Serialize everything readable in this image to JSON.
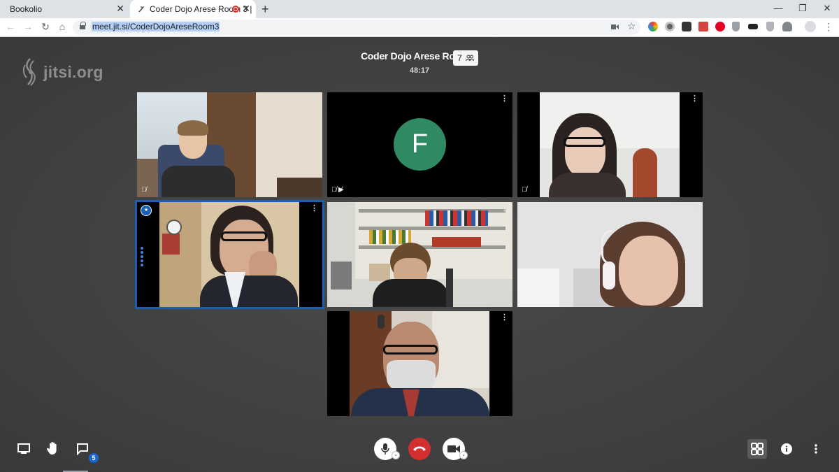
{
  "browser": {
    "tabs": [
      {
        "title": "Bookolio",
        "active": false
      },
      {
        "title": "Coder Dojo Arese Room 3 |",
        "active": true,
        "recording": true
      }
    ],
    "new_tab_label": "+",
    "window_controls": {
      "minimize": "—",
      "restore": "❐",
      "close": "✕"
    },
    "url": "meet.jit.si/CoderDojoAreseRoom3",
    "extensions": [
      "color-picker-icon",
      "record-icon",
      "spy-icon",
      "pdf-icon",
      "pinterest-icon",
      "shield-icon",
      "mask-icon",
      "shield-gray-icon",
      "cloud-icon",
      "profile-icon"
    ]
  },
  "meeting": {
    "logo_text": "jitsi.org",
    "room_name": "Coder Dojo Arese Room 3",
    "participant_count": "7",
    "elapsed": "48:17",
    "tiles": [
      {
        "type": "video",
        "muted": true
      },
      {
        "type": "avatar",
        "initial": "F",
        "muted": true,
        "video_off": true,
        "avatar_color": "#2f8a63"
      },
      {
        "type": "video",
        "muted": true
      },
      {
        "type": "video",
        "dominant_speaker": true
      },
      {
        "type": "video"
      },
      {
        "type": "video"
      },
      {
        "type": "video"
      }
    ]
  },
  "toolbar": {
    "chat_badge": "5",
    "colors": {
      "hangup": "#d32f2f",
      "accent": "#1a66d2"
    }
  }
}
